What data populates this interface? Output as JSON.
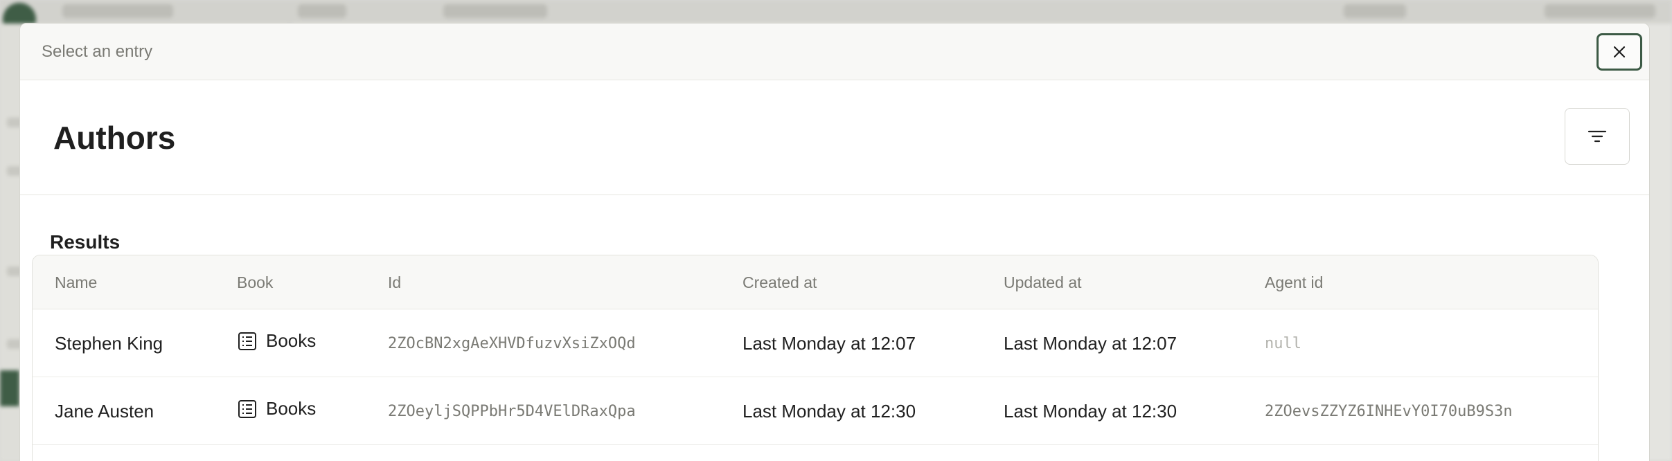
{
  "modal": {
    "title": "Select an entry",
    "page_title": "Authors",
    "results_label": "Results"
  },
  "table": {
    "columns": [
      "Name",
      "Book",
      "Id",
      "Created at",
      "Updated at",
      "Agent id"
    ],
    "rows": [
      {
        "name": "Stephen King",
        "book": "Books",
        "id": "2ZOcBN2xgAeXHVDfuzvXsiZxOQd",
        "created_at": "Last Monday at 12:07",
        "updated_at": "Last Monday at 12:07",
        "agent_id": "null"
      },
      {
        "name": "Jane Austen",
        "book": "Books",
        "id": "2ZOeyljSQPPbHr5D4VElDRaxQpa",
        "created_at": "Last Monday at 12:30",
        "updated_at": "Last Monday at 12:30",
        "agent_id": "2ZOevsZZYZ6INHEvY0I70uB9S3n"
      }
    ]
  },
  "icons": {
    "close": "close-icon",
    "filter": "filter-icon",
    "book": "table-list-icon"
  },
  "colors": {
    "accent": "#3c5a45"
  }
}
